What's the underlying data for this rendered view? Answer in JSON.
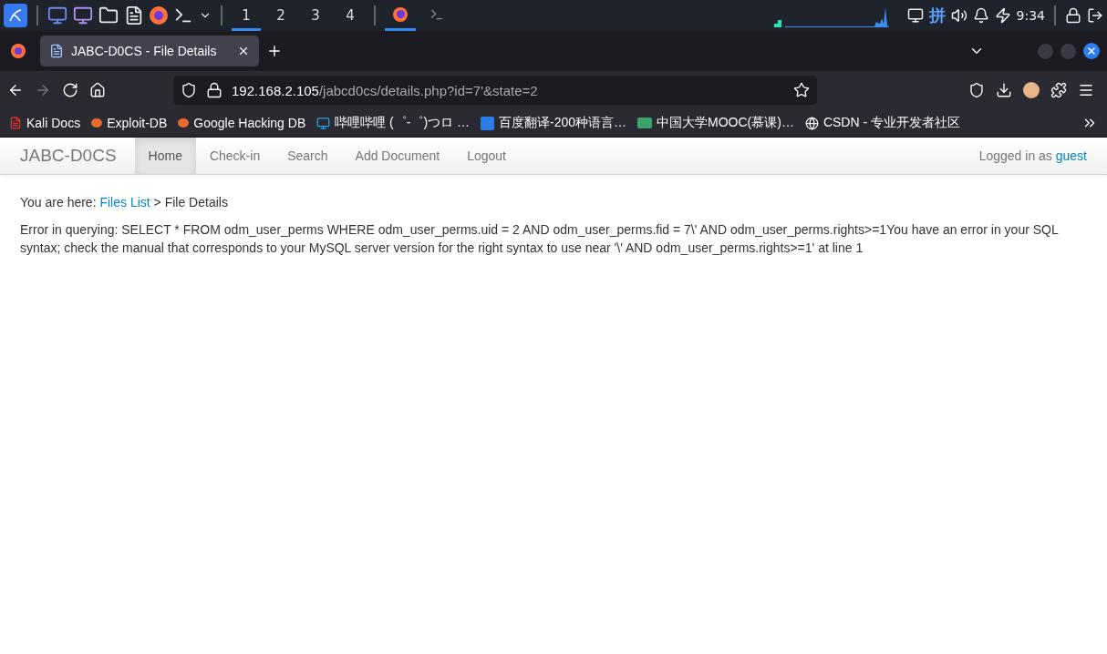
{
  "taskbar": {
    "workspaces": [
      {
        "label": "1",
        "selected": true
      },
      {
        "label": "2",
        "selected": false
      },
      {
        "label": "3",
        "selected": false
      },
      {
        "label": "4",
        "selected": false
      }
    ],
    "tasks": [
      {
        "kind": "browser",
        "selected": true
      },
      {
        "kind": "terminal",
        "selected": false
      }
    ],
    "input_method": "拼",
    "clock": "9:34"
  },
  "browser": {
    "tab": {
      "title": "JABC-D0CS - File Details",
      "selected": true
    },
    "url": {
      "host": "192.168.2.105",
      "path": "/jabcd0cs/details.php?id=7'&state=2"
    },
    "bookmarks": [
      "Kali Docs",
      "Exploit-DB",
      "Google Hacking DB",
      "哔哩哔哩 (゜-゜)つロ …",
      "百度翻译-200种语言…",
      "中国大学MOOC(慕课)…",
      "CSDN - 专业开发者社区"
    ]
  },
  "page": {
    "brand": "JABC-D0CS",
    "nav": [
      {
        "label": "Home",
        "selected": true
      },
      {
        "label": "Check-in",
        "selected": false
      },
      {
        "label": "Search",
        "selected": false
      },
      {
        "label": "Add Document",
        "selected": false
      },
      {
        "label": "Logout",
        "selected": false
      }
    ],
    "login": {
      "text": "Logged in as",
      "user": "guest"
    },
    "breadcrumb": {
      "prefix": "You are here:",
      "link": "Files List",
      "current": "> File Details"
    },
    "error": "Error in querying: SELECT * FROM odm_user_perms WHERE odm_user_perms.uid = 2 AND odm_user_perms.fid = 7\\' AND odm_user_perms.rights>=1You have an error in your SQL syntax; check the manual that corresponds to your MySQL server version for the right syntax to use near '\\' AND odm_user_perms.rights>=1' at line 1"
  }
}
